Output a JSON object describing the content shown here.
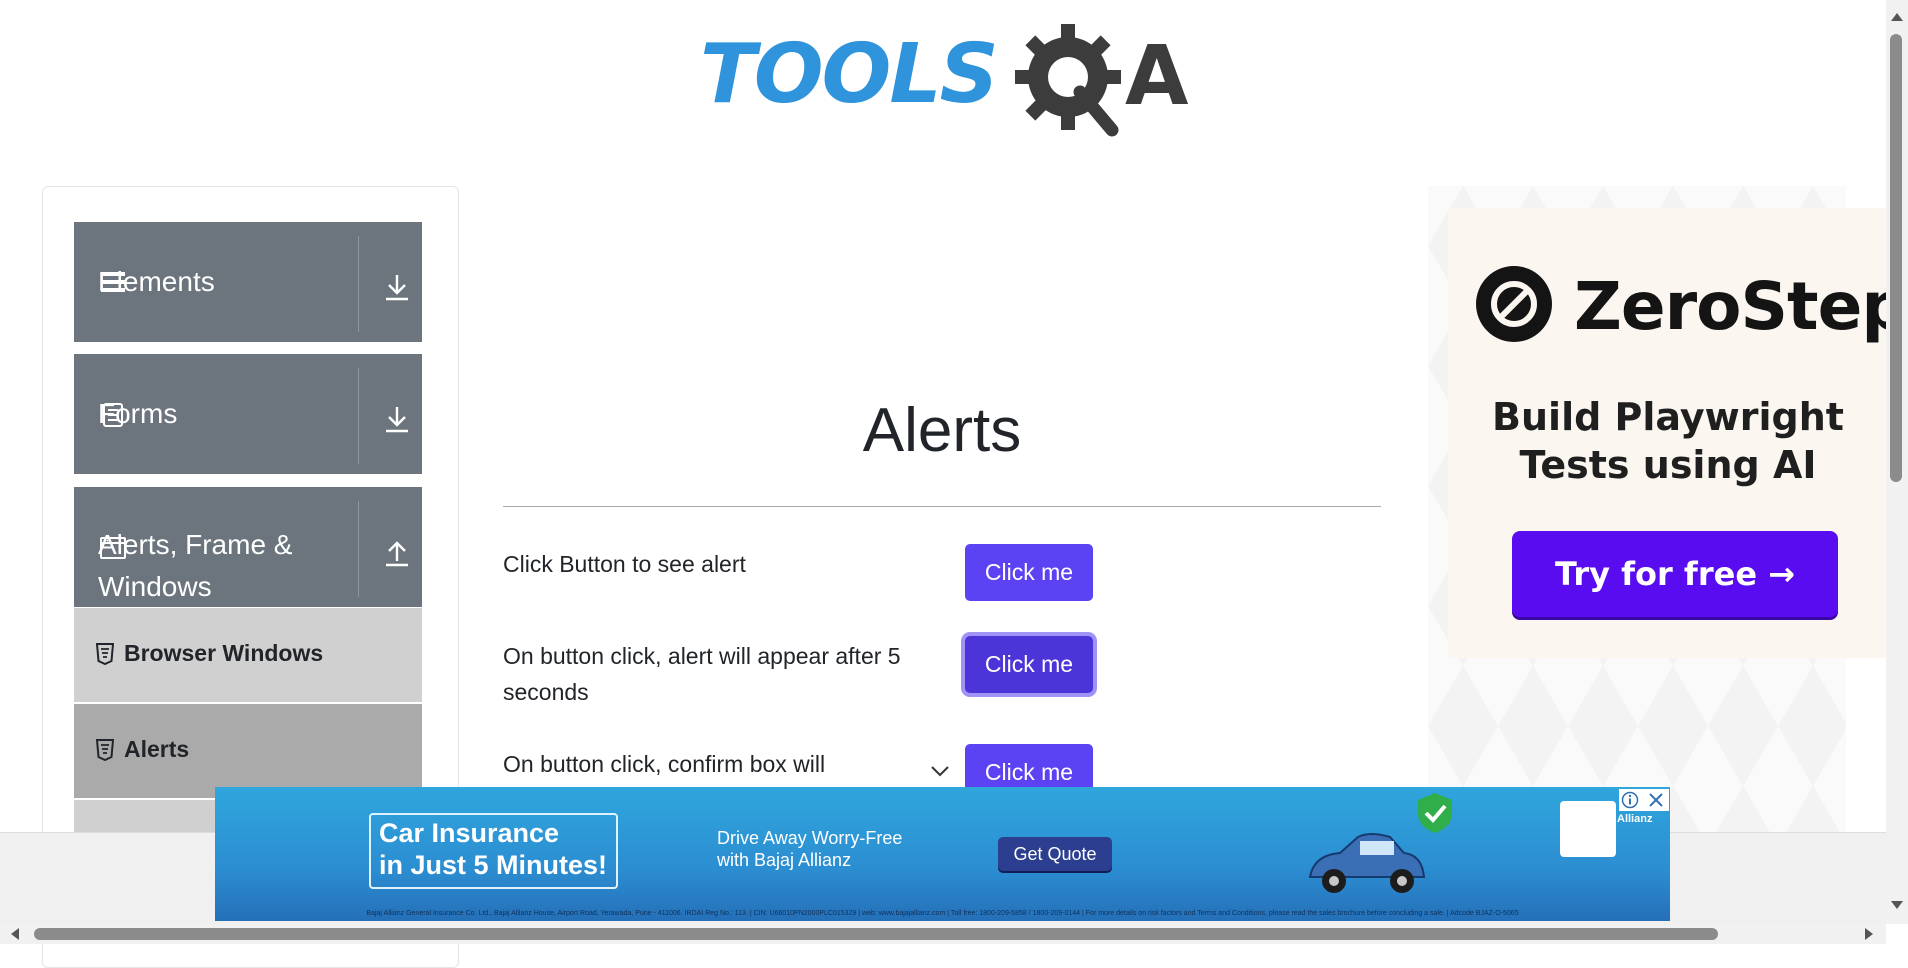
{
  "header": {
    "logo_left": "TOOLS",
    "logo_right": "A"
  },
  "sidebar": {
    "groups": [
      {
        "label": "Elements",
        "icon": "hamburger-icon",
        "arrow": "download-icon"
      },
      {
        "label": "Forms",
        "icon": "document-icon",
        "arrow": "download-icon"
      },
      {
        "label_line1": "Alerts, Frame &",
        "label_line2": "Windows",
        "icon": "window-icon",
        "arrow": "upload-icon"
      }
    ],
    "items": [
      {
        "label": "Browser Windows",
        "active": false
      },
      {
        "label": "Alerts",
        "active": true
      }
    ]
  },
  "main": {
    "title": "Alerts",
    "rows": [
      {
        "text": "Click Button to see alert",
        "button": "Click me"
      },
      {
        "text": "On button click, alert will appear after 5 seconds",
        "button": "Click me"
      },
      {
        "text": "On button click, confirm box will",
        "button": "Click me"
      }
    ]
  },
  "right_ad": {
    "brand": "ZeroStep",
    "tagline_line1": "Build Playwright",
    "tagline_line2": "Tests using AI",
    "cta": "Try for free →"
  },
  "bottom_ad": {
    "headline_line1": "Car Insurance",
    "headline_line2": "in Just 5 Minutes!",
    "sub_line1": "Drive Away Worry-Free",
    "sub_line2": "with Bajaj Allianz",
    "cta": "Get Quote",
    "brand": "Allianz",
    "fine_print": "Bajaj Allianz General Insurance Co. Ltd., Bajaj Allianz House, Airport Road, Yerawada, Pune - 411006. IRDAI Reg No.: 113. | CIN: U66010PN2000PLC015329 | web: www.bajajallianz.com | Toll free: 1800-209-5858 / 1800-209-0144 | For more details on risk factors and Terms and Conditions, please read the sales brochure before concluding a sale. | Adcode BJAZ-O-5065"
  },
  "colors": {
    "button": "#5b43f3",
    "sidebar_group": "#6c757d",
    "sidebar_item": "#d0d0d0",
    "sidebar_item_active": "#aaaaaa",
    "logo_blue": "#2f94dc",
    "cta_purple": "#5a0cf0"
  }
}
